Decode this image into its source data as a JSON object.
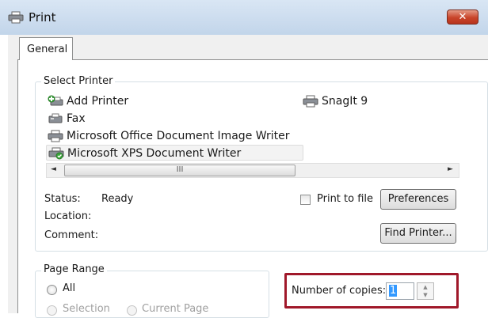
{
  "window": {
    "title": "Print",
    "close_label": "✕"
  },
  "tabs": [
    {
      "label": "General"
    }
  ],
  "select_printer": {
    "label": "Select Printer",
    "printers": [
      {
        "name": "Add Printer",
        "icon": "add-printer-icon"
      },
      {
        "name": "Fax",
        "icon": "fax-icon"
      },
      {
        "name": "Microsoft Office Document Image Writer",
        "icon": "printer-icon"
      },
      {
        "name": "Microsoft XPS Document Writer",
        "icon": "default-printer-icon",
        "selected": true
      },
      {
        "name": "SnagIt 9",
        "icon": "printer-icon"
      }
    ],
    "scroll_left": "◄",
    "scroll_right": "►",
    "scroll_grip": "III"
  },
  "status": {
    "status_label": "Status:",
    "status_value": "Ready",
    "location_label": "Location:",
    "comment_label": "Comment:"
  },
  "print_to_file": {
    "label": "Print to file",
    "checked": false
  },
  "buttons": {
    "preferences": "Preferences",
    "find_printer": "Find Printer..."
  },
  "page_range": {
    "label": "Page Range",
    "options": [
      {
        "label": "All",
        "selected": true,
        "enabled": true
      },
      {
        "label": "Selection",
        "selected": false,
        "enabled": false
      },
      {
        "label": "Current Page",
        "selected": false,
        "enabled": false
      }
    ]
  },
  "copies": {
    "label": "Number of copies:",
    "value": "1"
  },
  "colors": {
    "highlight_border": "#a0182a",
    "selection_blue": "#3399ff",
    "title_bar": "#c2d5ea"
  }
}
